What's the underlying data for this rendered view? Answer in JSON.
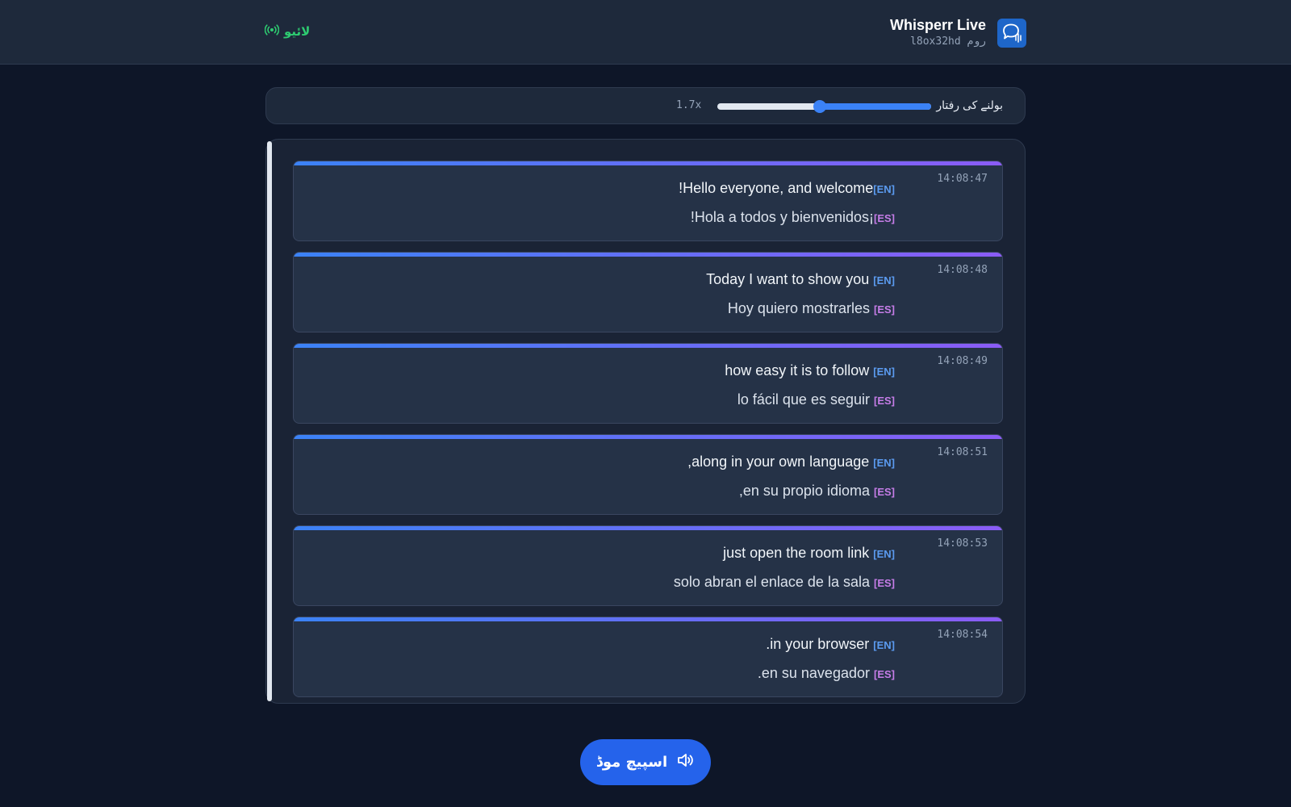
{
  "header": {
    "title": "Whisperr Live",
    "room": "روم l8ox32hd",
    "live_label": "لائیو",
    "logo_icon": "speech-bubble-waveform-icon",
    "live_icon": "broadcast-icon"
  },
  "speed": {
    "label": "بولنے کی رفتار",
    "value_text": "1.7x",
    "level_fraction": 0.48
  },
  "transcript": {
    "entries": [
      {
        "time": "14:08:47",
        "en_tag": "[EN]",
        "en_text": "Hello everyone, and welcome!",
        "es_tag": "[ES]",
        "es_text": "¡Hola a todos y bienvenidos!"
      },
      {
        "time": "14:08:48",
        "en_tag": "[EN]",
        "en_text": "Today I want to show you",
        "es_tag": "[ES]",
        "es_text": "Hoy quiero mostrarles"
      },
      {
        "time": "14:08:49",
        "en_tag": "[EN]",
        "en_text": "how easy it is to follow",
        "es_tag": "[ES]",
        "es_text": "lo fácil que es seguir"
      },
      {
        "time": "14:08:51",
        "en_tag": "[EN]",
        "en_text": "along in your own language,",
        "es_tag": "[ES]",
        "es_text": "en su propio idioma,"
      },
      {
        "time": "14:08:53",
        "en_tag": "[EN]",
        "en_text": "just open the room link",
        "es_tag": "[ES]",
        "es_text": "solo abran el enlace de la sala"
      },
      {
        "time": "14:08:54",
        "en_tag": "[EN]",
        "en_text": "in your browser.",
        "es_tag": "[ES]",
        "es_text": "en su navegador."
      }
    ]
  },
  "speech_button": {
    "label": "اسپیچ موڈ",
    "icon": "speaker-icon"
  },
  "colors": {
    "accent": "#3b82f6",
    "accent_purple": "#8b5cf6",
    "live_green": "#2ecc71",
    "en_tag": "#5b9bf0",
    "es_tag": "#c67de8"
  }
}
